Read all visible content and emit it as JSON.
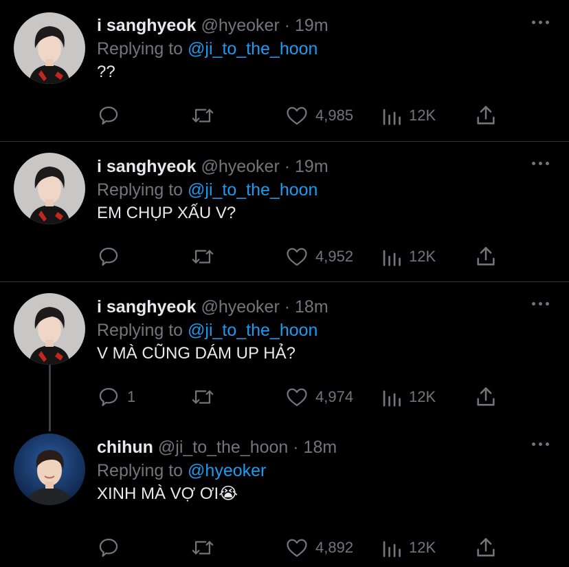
{
  "tweets": [
    {
      "name": "i sanghyeok",
      "handle": "@hyeoker",
      "separator": "·",
      "time": "19m",
      "replying_prefix": "Replying to",
      "replying_to": "@ji_to_the_hoon",
      "text": "??",
      "reply_count": "",
      "likes": "4,985",
      "views": "12K",
      "avatar": "avatar-dark-hair"
    },
    {
      "name": "i sanghyeok",
      "handle": "@hyeoker",
      "separator": "·",
      "time": "19m",
      "replying_prefix": "Replying to",
      "replying_to": "@ji_to_the_hoon",
      "text": "EM CHỤP XẤU V?",
      "reply_count": "",
      "likes": "4,952",
      "views": "12K",
      "avatar": "avatar-dark-hair"
    },
    {
      "name": "i sanghyeok",
      "handle": "@hyeoker",
      "separator": "·",
      "time": "18m",
      "replying_prefix": "Replying to",
      "replying_to": "@ji_to_the_hoon",
      "text": "V MÀ CŨNG DÁM UP HẢ?",
      "reply_count": "1",
      "likes": "4,974",
      "views": "12K",
      "avatar": "avatar-dark-hair"
    },
    {
      "name": "chihun",
      "handle": "@ji_to_the_hoon",
      "separator": "·",
      "time": "18m",
      "replying_prefix": "Replying to",
      "replying_to": "@hyeoker",
      "text": "XINH MÀ VỢ ƠI😭",
      "reply_count": "",
      "likes": "4,892",
      "views": "12K",
      "avatar": "avatar-blue-bg"
    }
  ],
  "icons": {
    "reply": "reply-icon",
    "retweet": "retweet-icon",
    "like": "heart-icon",
    "views": "views-icon",
    "share": "share-icon",
    "more": "more-icon"
  },
  "colors": {
    "background": "#000000",
    "text": "#e7e9ea",
    "muted": "#71767b",
    "link": "#1d9bf0",
    "divider": "#2f3336"
  }
}
